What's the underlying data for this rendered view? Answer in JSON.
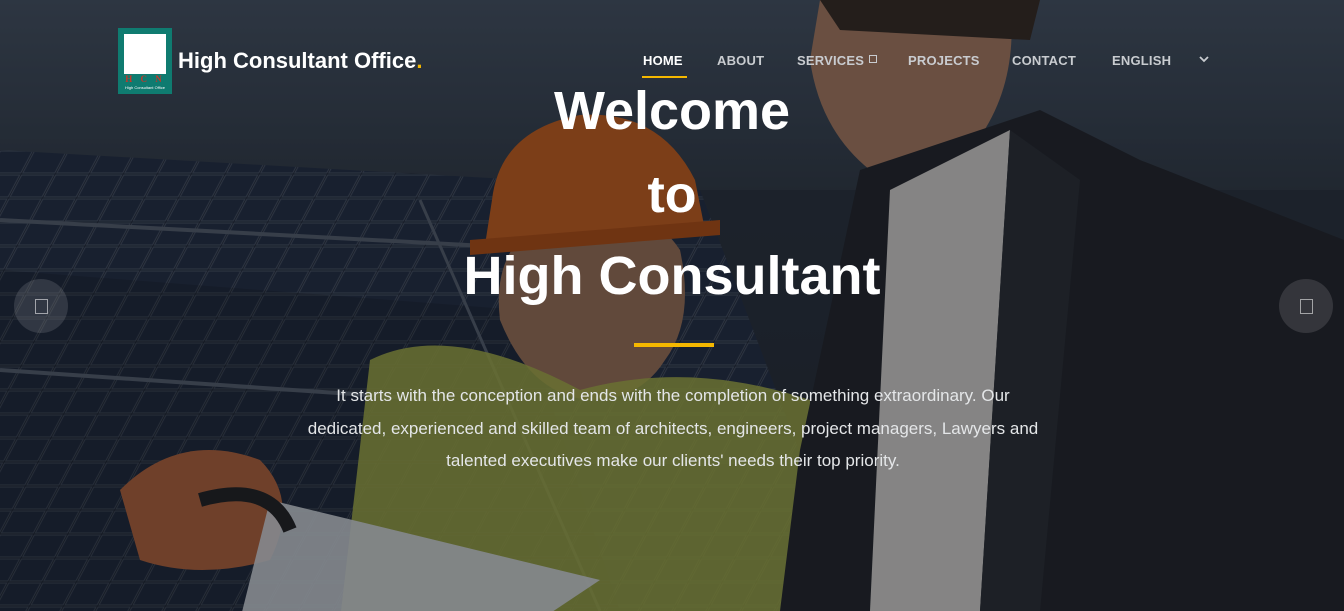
{
  "brand": {
    "name": "High Consultant Office",
    "dot": ".",
    "logo_letters": "H C N",
    "logo_sub": "High Consultant Office"
  },
  "nav": {
    "items": [
      {
        "label": "HOME",
        "active": true
      },
      {
        "label": "ABOUT"
      },
      {
        "label": "SERVICES"
      },
      {
        "label": "PROJECTS"
      },
      {
        "label": "CONTACT"
      },
      {
        "label": "ENGLISH"
      }
    ]
  },
  "hero": {
    "line1": "Welcome",
    "line2": "to",
    "line3": "High Consultant",
    "description": "It starts with the conception and ends with the completion of something extraordinary. Our dedicated, experienced and skilled team of architects, engineers, project managers, Lawyers and talented executives make our clients' needs their top priority."
  },
  "colors": {
    "accent": "#f5b800",
    "logo_green": "#0f7b70"
  },
  "icons": {
    "slider_prev": "chevron-left-icon",
    "slider_next": "chevron-right-icon",
    "language_dropdown": "chevron-down-icon",
    "services_dropdown": "square-icon"
  }
}
